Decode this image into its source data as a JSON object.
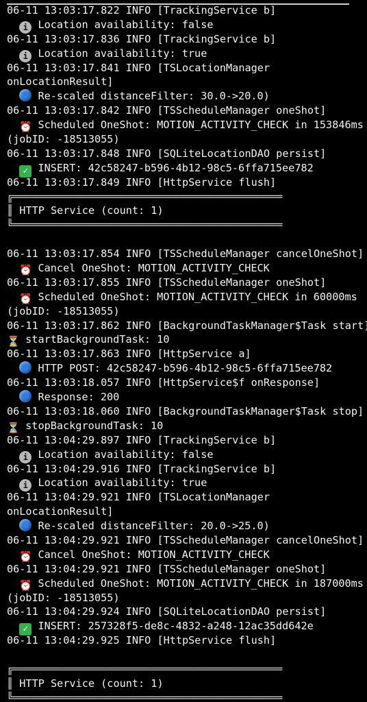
{
  "box_top": "╔═══════════════════════════════════════════",
  "box_bottom": "╚═══════════════════════════════════════════",
  "lines": [
    {
      "type": "log",
      "text": "06-11 13:03:17.822 INFO [TrackingService b]"
    },
    {
      "type": "msg",
      "icon": "info-icon",
      "text": "Location availability: false",
      "indent": "  "
    },
    {
      "type": "log",
      "text": "06-11 13:03:17.836 INFO [TrackingService b]"
    },
    {
      "type": "msg",
      "icon": "info-icon",
      "text": "Location availability: true",
      "indent": "  "
    },
    {
      "type": "log",
      "text": "06-11 13:03:17.841 INFO [TSLocationManager"
    },
    {
      "type": "log",
      "text": "onLocationResult]"
    },
    {
      "type": "msg",
      "icon": "blue-circle-icon",
      "text": "Re-scaled distanceFilter: 30.0->20.0)",
      "indent": "  "
    },
    {
      "type": "log",
      "text": "06-11 13:03:17.842 INFO [TSScheduleManager oneShot]"
    },
    {
      "type": "msg",
      "icon": "alarm-clock-icon",
      "text": "Scheduled OneShot: MOTION_ACTIVITY_CHECK in 153846ms",
      "indent": "  "
    },
    {
      "type": "log",
      "text": "(jobID: -18513055)"
    },
    {
      "type": "log",
      "text": "06-11 13:03:17.848 INFO [SQLiteLocationDAO persist]"
    },
    {
      "type": "msg",
      "icon": "check-icon",
      "text": "INSERT: 42c58247-b596-4b12-98c5-6ffa715ee782",
      "indent": "  "
    },
    {
      "type": "log",
      "text": "06-11 13:03:17.849 INFO [HttpService flush]"
    },
    {
      "type": "box-top"
    },
    {
      "type": "log",
      "text": "║ HTTP Service (count: 1)"
    },
    {
      "type": "box-bottom"
    },
    {
      "type": "blank"
    },
    {
      "type": "log",
      "text": "06-11 13:03:17.854 INFO [TSScheduleManager cancelOneShot]"
    },
    {
      "type": "msg",
      "icon": "alarm-clock-icon",
      "text": "Cancel OneShot: MOTION_ACTIVITY_CHECK",
      "indent": "  "
    },
    {
      "type": "log",
      "text": "06-11 13:03:17.855 INFO [TSScheduleManager oneShot]"
    },
    {
      "type": "msg",
      "icon": "alarm-clock-icon",
      "text": "Scheduled OneShot: MOTION_ACTIVITY_CHECK in 60000ms",
      "indent": "  "
    },
    {
      "type": "log",
      "text": "(jobID: -18513055)"
    },
    {
      "type": "log",
      "text": "06-11 13:03:17.862 INFO [BackgroundTaskManager$Task start]"
    },
    {
      "type": "msg",
      "icon": "hourglass-icon",
      "text": "startBackgroundTask: 10",
      "indent": ""
    },
    {
      "type": "log",
      "text": "06-11 13:03:17.863 INFO [HttpService a]"
    },
    {
      "type": "msg",
      "icon": "blue-circle-icon",
      "text": "HTTP POST: 42c58247-b596-4b12-98c5-6ffa715ee782",
      "indent": "  "
    },
    {
      "type": "log",
      "text": "06-11 13:03:18.057 INFO [HttpService$f onResponse]"
    },
    {
      "type": "msg",
      "icon": "blue-circle-icon",
      "text": "Response: 200",
      "indent": "  "
    },
    {
      "type": "log",
      "text": "06-11 13:03:18.060 INFO [BackgroundTaskManager$Task stop]"
    },
    {
      "type": "msg",
      "icon": "hourglass-icon",
      "text": "stopBackgroundTask: 10",
      "indent": ""
    },
    {
      "type": "log",
      "text": "06-11 13:04:29.897 INFO [TrackingService b]"
    },
    {
      "type": "msg",
      "icon": "info-icon",
      "text": "Location availability: false",
      "indent": "  "
    },
    {
      "type": "log",
      "text": "06-11 13:04:29.916 INFO [TrackingService b]"
    },
    {
      "type": "msg",
      "icon": "info-icon",
      "text": "Location availability: true",
      "indent": "  "
    },
    {
      "type": "log",
      "text": "06-11 13:04:29.921 INFO [TSLocationManager"
    },
    {
      "type": "log",
      "text": "onLocationResult]"
    },
    {
      "type": "msg",
      "icon": "blue-circle-icon",
      "text": "Re-scaled distanceFilter: 20.0->25.0)",
      "indent": "  "
    },
    {
      "type": "log",
      "text": "06-11 13:04:29.921 INFO [TSScheduleManager cancelOneShot]"
    },
    {
      "type": "msg",
      "icon": "alarm-clock-icon",
      "text": "Cancel OneShot: MOTION_ACTIVITY_CHECK",
      "indent": "  "
    },
    {
      "type": "log",
      "text": "06-11 13:04:29.921 INFO [TSScheduleManager oneShot]"
    },
    {
      "type": "msg",
      "icon": "alarm-clock-icon",
      "text": "Scheduled OneShot: MOTION_ACTIVITY_CHECK in 187000ms",
      "indent": "  "
    },
    {
      "type": "log",
      "text": "(jobID: -18513055)"
    },
    {
      "type": "log",
      "text": "06-11 13:04:29.924 INFO [SQLiteLocationDAO persist]"
    },
    {
      "type": "msg",
      "icon": "check-icon",
      "text": "INSERT: 257328f5-de8c-4832-a248-12ac35dd642e",
      "indent": "  "
    },
    {
      "type": "log",
      "text": "06-11 13:04:29.925 INFO [HttpService flush]"
    },
    {
      "type": "blank"
    },
    {
      "type": "box-top"
    },
    {
      "type": "log",
      "text": "║ HTTP Service (count: 1)"
    },
    {
      "type": "box-bottom"
    }
  ]
}
